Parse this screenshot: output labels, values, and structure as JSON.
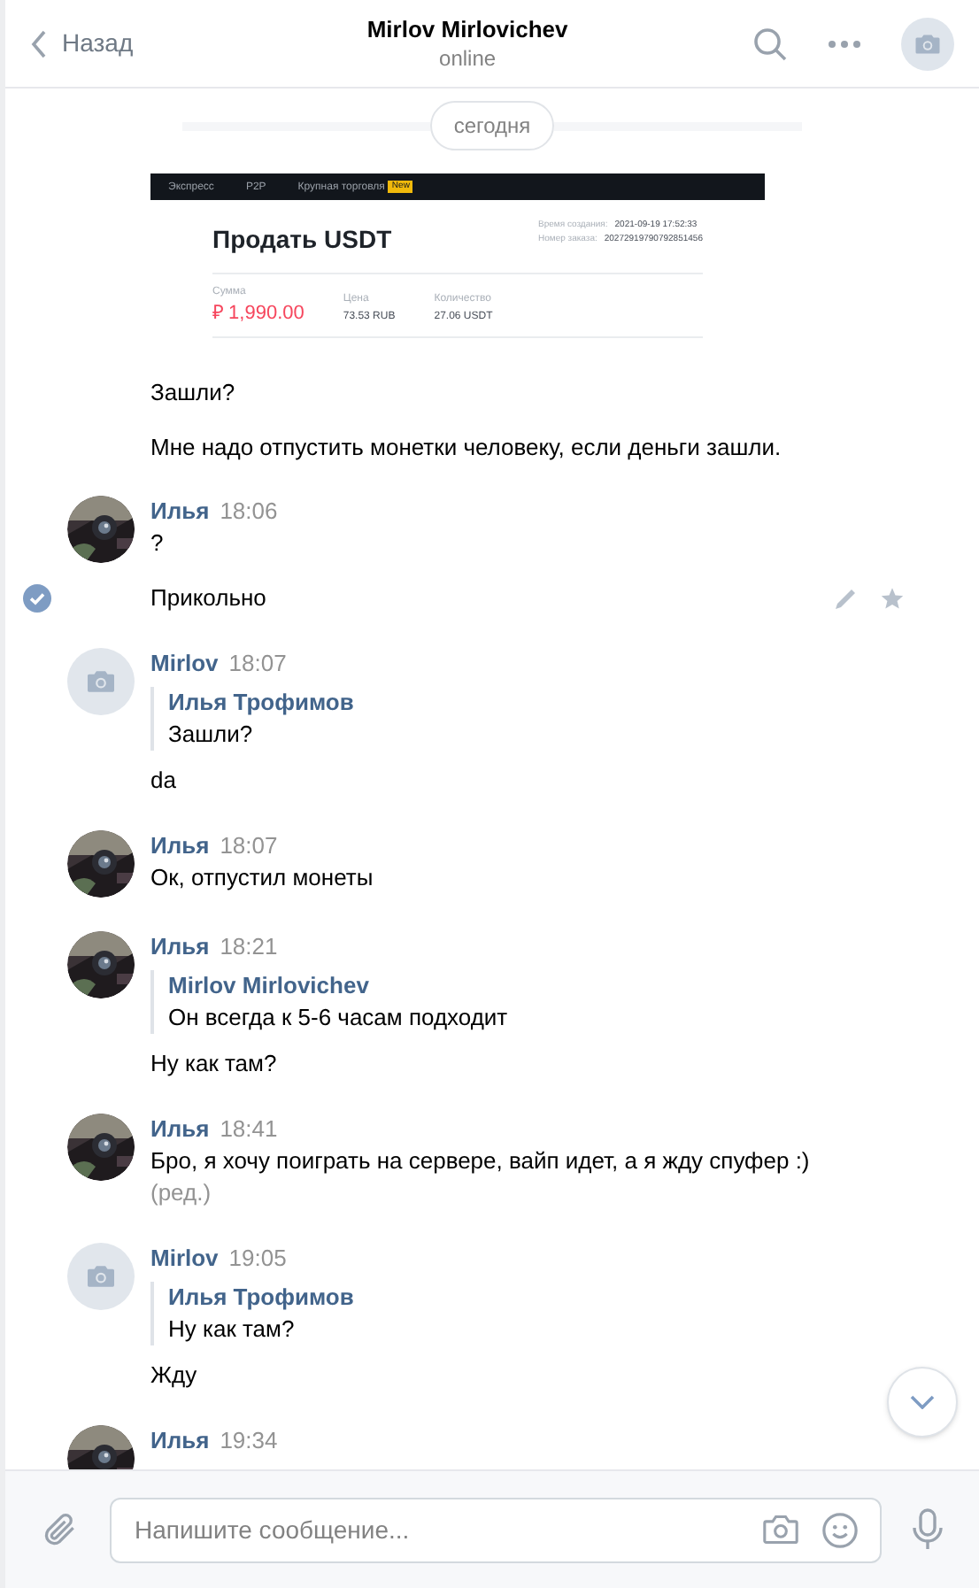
{
  "header": {
    "back_label": "Назад",
    "title": "Mirlov Mirlovichev",
    "status": "online"
  },
  "date_divider": "сегодня",
  "groups": [
    {
      "items": [
        {
          "kind": "screenshot",
          "tabs": [
            "Экспресс",
            "P2P",
            "Крупная торговля"
          ],
          "badge": "New",
          "title": "Продать USDT",
          "meta": [
            {
              "label": "Время создания:",
              "value": "2021-09-19 17:52:33"
            },
            {
              "label": "Номер заказа:",
              "value": "20272919790792851456"
            }
          ],
          "stats": [
            {
              "label": "Сумма",
              "value": "₽ 1,990.00",
              "kind": "amount"
            },
            {
              "label": "Цена",
              "value": "73.53 RUB",
              "kind": "plain"
            },
            {
              "label": "Количество",
              "value": "27.06 USDT",
              "kind": "plain"
            }
          ]
        },
        {
          "kind": "text",
          "text": "Зашли?",
          "selected": false
        },
        {
          "kind": "text",
          "text": "Мне надо отпустить монетки человеку, если деньги зашли.",
          "selected": false
        }
      ]
    },
    {
      "author": {
        "name": "Илья",
        "time": "18:06"
      },
      "items": [
        {
          "kind": "text",
          "text": "?",
          "selected": false
        },
        {
          "kind": "text",
          "text": "Прикольно",
          "selected": true
        }
      ]
    },
    {
      "author": {
        "name": "Mirlov",
        "time": "18:07",
        "avatar": {
          "kind": "placeholder"
        }
      },
      "items": [
        {
          "kind": "quote",
          "author": "Илья Трофимов",
          "text": "Зашли?"
        },
        {
          "kind": "text",
          "text": "da",
          "selected": false
        }
      ]
    },
    {
      "author": {
        "name": "Илья",
        "time": "18:07"
      },
      "items": [
        {
          "kind": "text",
          "text": "Ок, отпустил монеты",
          "selected": false
        }
      ]
    },
    {
      "author": {
        "name": "Илья",
        "time": "18:21"
      },
      "items": [
        {
          "kind": "quote",
          "author": "Mirlov Mirlovichev",
          "text": "Он всегда к 5-6 часам подходит"
        },
        {
          "kind": "text",
          "text": "Ну как там?",
          "selected": false
        }
      ]
    },
    {
      "author": {
        "name": "Илья",
        "time": "18:41"
      },
      "items": [
        {
          "kind": "text",
          "text": "Бро, я хочу поиграть на сервере, вайп идет, а я жду спуфер :)",
          "edited_label": "(ред.)",
          "selected": false
        }
      ]
    },
    {
      "author": {
        "name": "Mirlov",
        "time": "19:05",
        "avatar": {
          "kind": "placeholder"
        }
      },
      "items": [
        {
          "kind": "quote",
          "author": "Илья Трофимов",
          "text": "Ну как там?"
        },
        {
          "kind": "text",
          "text": "Жду",
          "selected": false
        }
      ]
    },
    {
      "author": {
        "name": "Илья",
        "time": "19:34"
      }
    }
  ],
  "composer": {
    "placeholder": "Напишите сообщение..."
  }
}
